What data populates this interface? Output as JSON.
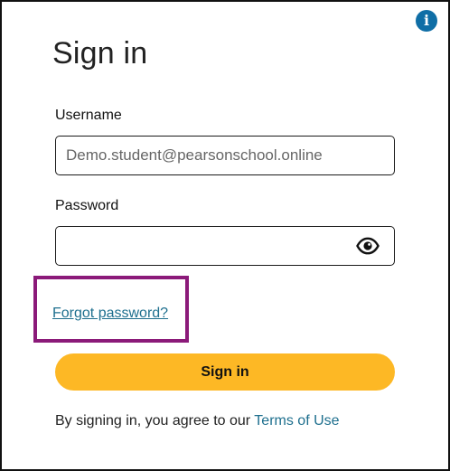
{
  "header": {
    "info_icon": "info-icon",
    "info_glyph": "i",
    "info_color": "#0f6ea6"
  },
  "form": {
    "title": "Sign in",
    "username_label": "Username",
    "username_value": "Demo.student@pearsonschool.online",
    "password_label": "Password",
    "password_value": "",
    "password_toggle_icon": "eye-icon",
    "forgot_password_link": "Forgot password?",
    "submit_label": "Sign in",
    "agreement_prefix": "By signing in, you agree to our",
    "terms_link": "Terms of Use"
  },
  "colors": {
    "primary_button": "#fdb825",
    "link": "#1e6f8e",
    "highlight_border": "#8b1a79"
  }
}
